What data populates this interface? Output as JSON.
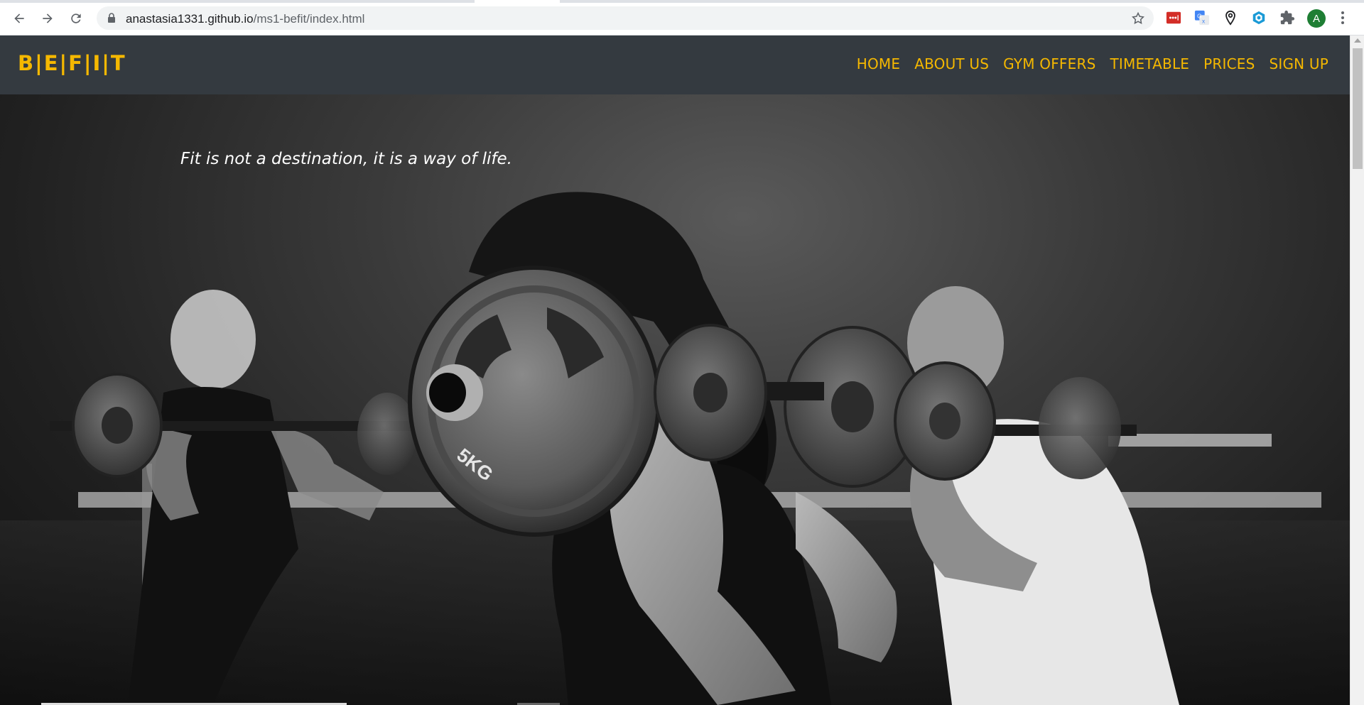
{
  "browser": {
    "url_host": "anastasia1331.github.io",
    "url_path": "/ms1-befit/index.html",
    "avatar_letter": "A",
    "extensions": [
      "lastpass-icon",
      "google-translate-icon",
      "location-pin-icon",
      "hexagon-extension-icon",
      "puzzle-extensions-icon"
    ]
  },
  "site": {
    "brand": "B|E|F|I|T",
    "nav": [
      "HOME",
      "ABOUT US",
      "GYM OFFERS",
      "TIMETABLE",
      "PRICES",
      "SIGN UP"
    ],
    "tagline": "Fit is not a destination, it is a way of life.",
    "plate_label": "5KG"
  },
  "colors": {
    "accent": "#f5b800",
    "header_bg": "#343a40"
  }
}
